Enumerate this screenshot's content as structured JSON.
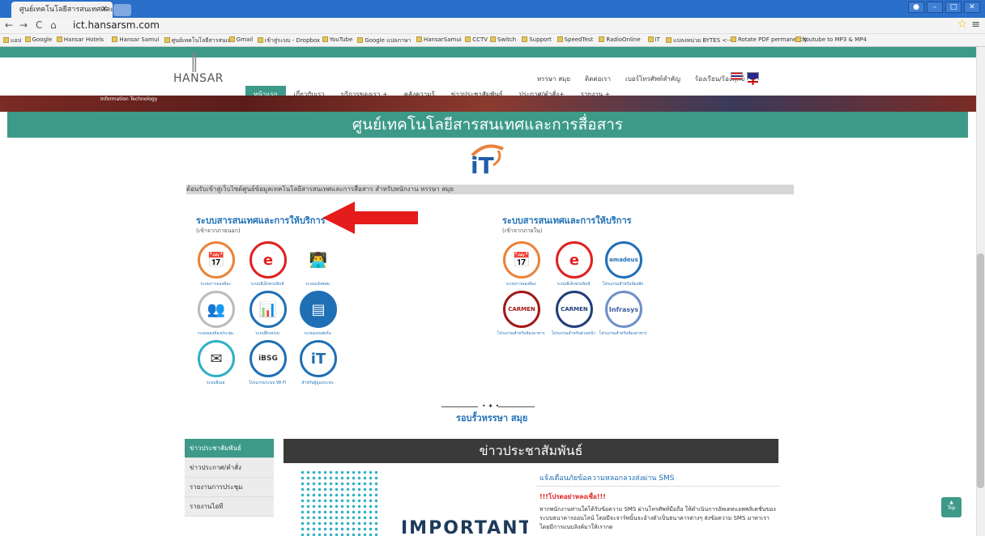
{
  "browser": {
    "tab_title": "ศูนย์เทคโนโลยีสารสนเทศและ",
    "url": "ict.hansarsm.com",
    "bookmarks": [
      "แอป",
      "Google",
      "Hansar Hotels",
      "Hansar Samui",
      "ศูนย์เทคโนโลยีสารสนเทศ",
      "Gmail",
      "เข้าสู่ระบบ - Dropbox",
      "YouTube",
      "Google แปลภาษา",
      "HansarSamui",
      "CCTV",
      "Switch",
      "Support",
      "SpeedTest",
      "RadioOnline",
      "IT",
      "แปลงหน่วย BYTES <-->",
      "Rotate PDF permanently",
      "Youtube to MP3 & MP4"
    ]
  },
  "header": {
    "logo_text": "HANSAR",
    "top_links": [
      "หรรษา สมุย",
      "ติดต่อเรา",
      "เบอร์โทรศัพท์สำคัญ",
      "ร้องเรียน/ร้องทุกข์"
    ],
    "nav": [
      "หน้าแรก",
      "เกี่ยวกับเรา",
      "บริการของเรา +",
      "คลังความรู้",
      "ข่าวประชาสัมพันธ์",
      "ประกาศ/คำสั่ง+",
      "รายงาน +"
    ],
    "banner_text": "Information Technology"
  },
  "title": "ศูนย์เทคโนโลยีสารสนเทศและการสื่อสาร",
  "welcome": "ต้อนรับเข้าสู่เว็บไซต์ศูนย์ข้อมูลเทคโนโลยีสารสนเทศและการสื่อสาร สำหรับพนักงาน หรรษา สมุย",
  "external": {
    "title": "ระบบสารสนเทศและการให้บริการ",
    "subtitle": "(เข้าจากภายนอก)",
    "items": [
      "ระบบการจองห้อง",
      "ระบบอีเล็กทรอนิกส์",
      "ระบบแจ้งซ่อม",
      "ระบบจองห้องประชุม",
      "ระบบฝึกอบรม",
      "ระบบแบบฟอร์ม",
      "ระบบอีเมล",
      "โปรแกรมระบบ Wi-Fi",
      "สำหรับผู้ดูแลระบบ"
    ]
  },
  "internal": {
    "title": "ระบบสารสนเทศและการให้บริการ",
    "subtitle": "(เข้าจากภายใน)",
    "items": [
      "ระบบการจองห้อง",
      "ระบบอีเล็กทรอนิกส์",
      "โปรแกรมสำหรับห้องพัก",
      "โปรแกรมสำหรับห้องอาหาร",
      "โปรแกรมสำหรับส่วนหน้า",
      "โปรแกรมสำหรับห้องอาหาร"
    ],
    "icon_labels": [
      "amadeus",
      "CARMEN",
      "CARMEN",
      "Infrasys"
    ]
  },
  "footer_brand": "รอบรั้วหรรษา สมุย",
  "sidebar": [
    "ข่าวประชาสัมพันธ์",
    "ข่าวประกาศ/คำสั่ง",
    "รายงานการประชุม",
    "รายงานไอที"
  ],
  "news": {
    "heading": "ข่าวประชาสัมพันธ์",
    "image_text": "IMPORTANT",
    "box_title": "แจ้งเตือนภัยข้อความหลอกลวงส่งผ่าน SMS",
    "warning": "!!!โปรดอย่าหลงเชื่อ!!!",
    "body": "หากพนักงานท่านใดได้รับข้อความ SMS ผ่านโทรศัพท์มือถือ ให้ดำเนินการอัพเดทแอพพลิเคชั่นของระบบธนาคารออนไลน์ โดยมีจะจาร์พนั้นจะอ้างตัวเป็นธนาคารต่างๆ ส่งข้อความ SMS มาหาเรา โดยมีการแนบลิงค์มาให้เรากด"
  },
  "top_button": "Top"
}
